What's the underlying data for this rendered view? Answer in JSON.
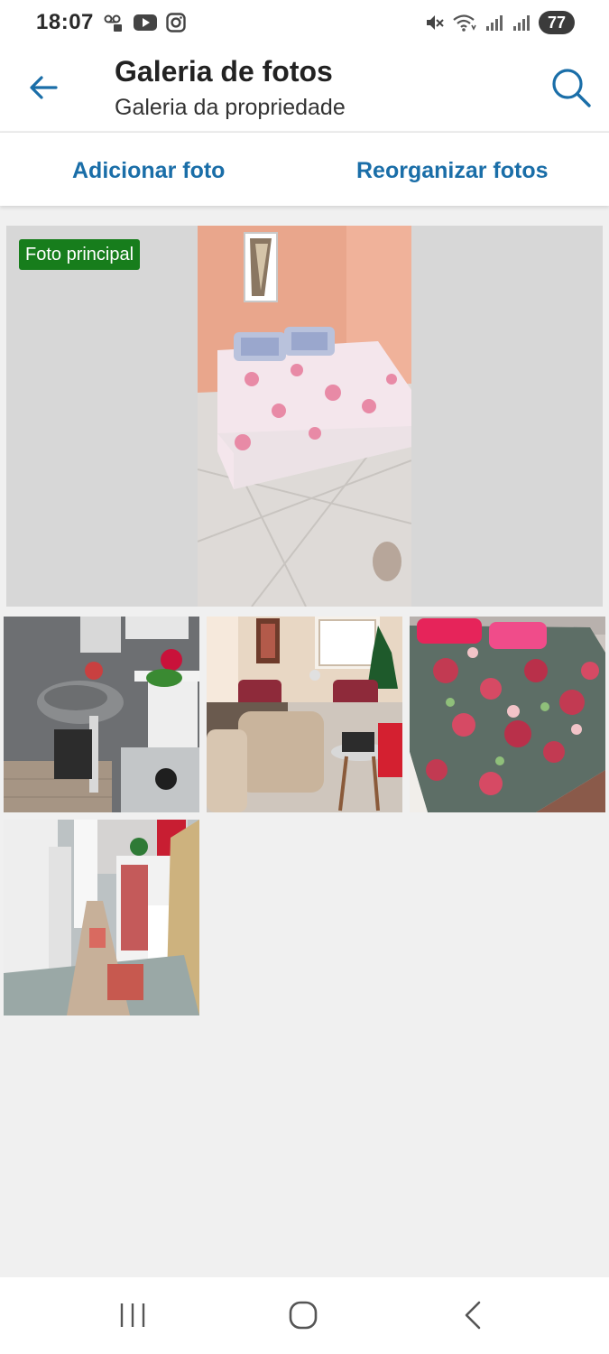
{
  "status_bar": {
    "time": "18:07",
    "battery": "77",
    "icons": [
      "voicemail-icon",
      "youtube-icon",
      "instagram-icon",
      "mute-icon",
      "wifi-icon",
      "signal-icon",
      "signal-icon",
      "battery-icon"
    ]
  },
  "app_bar": {
    "title": "Galeria de fotos",
    "subtitle": "Galeria da propriedade",
    "back_icon": "arrow-left-icon",
    "search_icon": "search-icon"
  },
  "actions": {
    "add_label": "Adicionar foto",
    "reorder_label": "Reorganizar fotos"
  },
  "gallery": {
    "main_badge": "Foto principal",
    "photos": [
      "bedroom",
      "bathroom",
      "living-room",
      "bedroom-2",
      "hallway"
    ]
  },
  "nav_bar": {
    "icons": [
      "recent-apps-icon",
      "home-icon",
      "back-icon"
    ]
  },
  "colors": {
    "accent": "#1a6ea8",
    "badge": "#177d1c",
    "background": "#f0f0f0"
  }
}
